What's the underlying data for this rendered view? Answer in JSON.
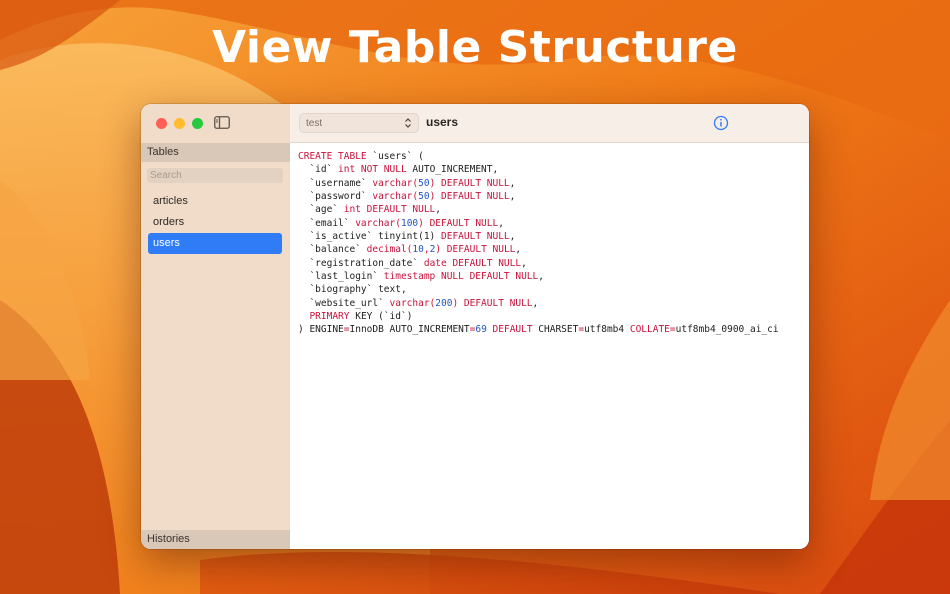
{
  "headline": "View Table Structure",
  "sidebar": {
    "tables_header": "Tables",
    "search_placeholder": "Search",
    "tables": [
      {
        "label": "articles",
        "selected": false
      },
      {
        "label": "orders",
        "selected": false
      },
      {
        "label": "users",
        "selected": true
      }
    ],
    "histories_header": "Histories"
  },
  "toolbar": {
    "database_select": "test",
    "table_name": "users",
    "icons": [
      "info-icon",
      "table-icon",
      "terminal-icon"
    ]
  },
  "colors": {
    "accent": "#2f7cf6",
    "keyword": "#c8123a",
    "number": "#1f55c2"
  },
  "sql": {
    "lines": [
      [
        [
          "kw",
          "CREATE TABLE"
        ],
        [
          "t",
          " `users` ("
        ]
      ],
      [
        [
          "t",
          "  `id` "
        ],
        [
          "kw",
          "int NOT NULL"
        ],
        [
          "t",
          " AUTO_INCREMENT,"
        ]
      ],
      [
        [
          "t",
          "  `username` "
        ],
        [
          "kw",
          "varchar("
        ],
        [
          "num",
          "50"
        ],
        [
          "kw",
          ") DEFAULT NULL"
        ],
        [
          "t",
          ","
        ]
      ],
      [
        [
          "t",
          "  `password` "
        ],
        [
          "kw",
          "varchar("
        ],
        [
          "num",
          "50"
        ],
        [
          "kw",
          ") DEFAULT NULL"
        ],
        [
          "t",
          ","
        ]
      ],
      [
        [
          "t",
          "  `age` "
        ],
        [
          "kw",
          "int DEFAULT NULL"
        ],
        [
          "t",
          ","
        ]
      ],
      [
        [
          "t",
          "  `email` "
        ],
        [
          "kw",
          "varchar("
        ],
        [
          "num",
          "100"
        ],
        [
          "kw",
          ") DEFAULT NULL"
        ],
        [
          "t",
          ","
        ]
      ],
      [
        [
          "t",
          "  `is_active` tinyint(1) "
        ],
        [
          "kw",
          "DEFAULT NULL"
        ],
        [
          "t",
          ","
        ]
      ],
      [
        [
          "t",
          "  `balance` "
        ],
        [
          "kw",
          "decimal("
        ],
        [
          "num",
          "10"
        ],
        [
          "kw",
          ","
        ],
        [
          "num",
          "2"
        ],
        [
          "kw",
          ") DEFAULT NULL"
        ],
        [
          "t",
          ","
        ]
      ],
      [
        [
          "t",
          "  `registration_date` "
        ],
        [
          "kw",
          "date DEFAULT NULL"
        ],
        [
          "t",
          ","
        ]
      ],
      [
        [
          "t",
          "  `last_login` "
        ],
        [
          "kw",
          "timestamp NULL DEFAULT NULL"
        ],
        [
          "t",
          ","
        ]
      ],
      [
        [
          "t",
          "  `biography` text,"
        ]
      ],
      [
        [
          "t",
          "  `website_url` "
        ],
        [
          "kw",
          "varchar("
        ],
        [
          "num",
          "200"
        ],
        [
          "kw",
          ") DEFAULT NULL"
        ],
        [
          "t",
          ","
        ]
      ],
      [
        [
          "t",
          "  "
        ],
        [
          "kw",
          "PRIMARY"
        ],
        [
          "t",
          " KEY (`id`)"
        ]
      ],
      [
        [
          "t",
          ") ENGINE"
        ],
        [
          "kw",
          "="
        ],
        [
          "t",
          "InnoDB AUTO_INCREMENT"
        ],
        [
          "kw",
          "="
        ],
        [
          "num",
          "69"
        ],
        [
          "t",
          " "
        ],
        [
          "kw",
          "DEFAULT"
        ],
        [
          "t",
          " CHARSET"
        ],
        [
          "kw",
          "="
        ],
        [
          "t",
          "utf8mb4 "
        ],
        [
          "kw",
          "COLLATE"
        ],
        [
          "kw",
          "="
        ],
        [
          "t",
          "utf8mb4_0900_ai_ci"
        ]
      ]
    ]
  }
}
